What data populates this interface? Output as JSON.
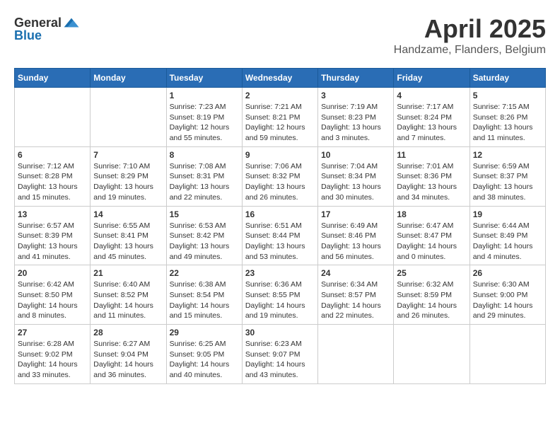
{
  "header": {
    "logo_general": "General",
    "logo_blue": "Blue",
    "title": "April 2025",
    "subtitle": "Handzame, Flanders, Belgium"
  },
  "weekdays": [
    "Sunday",
    "Monday",
    "Tuesday",
    "Wednesday",
    "Thursday",
    "Friday",
    "Saturday"
  ],
  "weeks": [
    [
      {
        "day": "",
        "detail": ""
      },
      {
        "day": "",
        "detail": ""
      },
      {
        "day": "1",
        "detail": "Sunrise: 7:23 AM\nSunset: 8:19 PM\nDaylight: 12 hours and 55 minutes."
      },
      {
        "day": "2",
        "detail": "Sunrise: 7:21 AM\nSunset: 8:21 PM\nDaylight: 12 hours and 59 minutes."
      },
      {
        "day": "3",
        "detail": "Sunrise: 7:19 AM\nSunset: 8:23 PM\nDaylight: 13 hours and 3 minutes."
      },
      {
        "day": "4",
        "detail": "Sunrise: 7:17 AM\nSunset: 8:24 PM\nDaylight: 13 hours and 7 minutes."
      },
      {
        "day": "5",
        "detail": "Sunrise: 7:15 AM\nSunset: 8:26 PM\nDaylight: 13 hours and 11 minutes."
      }
    ],
    [
      {
        "day": "6",
        "detail": "Sunrise: 7:12 AM\nSunset: 8:28 PM\nDaylight: 13 hours and 15 minutes."
      },
      {
        "day": "7",
        "detail": "Sunrise: 7:10 AM\nSunset: 8:29 PM\nDaylight: 13 hours and 19 minutes."
      },
      {
        "day": "8",
        "detail": "Sunrise: 7:08 AM\nSunset: 8:31 PM\nDaylight: 13 hours and 22 minutes."
      },
      {
        "day": "9",
        "detail": "Sunrise: 7:06 AM\nSunset: 8:32 PM\nDaylight: 13 hours and 26 minutes."
      },
      {
        "day": "10",
        "detail": "Sunrise: 7:04 AM\nSunset: 8:34 PM\nDaylight: 13 hours and 30 minutes."
      },
      {
        "day": "11",
        "detail": "Sunrise: 7:01 AM\nSunset: 8:36 PM\nDaylight: 13 hours and 34 minutes."
      },
      {
        "day": "12",
        "detail": "Sunrise: 6:59 AM\nSunset: 8:37 PM\nDaylight: 13 hours and 38 minutes."
      }
    ],
    [
      {
        "day": "13",
        "detail": "Sunrise: 6:57 AM\nSunset: 8:39 PM\nDaylight: 13 hours and 41 minutes."
      },
      {
        "day": "14",
        "detail": "Sunrise: 6:55 AM\nSunset: 8:41 PM\nDaylight: 13 hours and 45 minutes."
      },
      {
        "day": "15",
        "detail": "Sunrise: 6:53 AM\nSunset: 8:42 PM\nDaylight: 13 hours and 49 minutes."
      },
      {
        "day": "16",
        "detail": "Sunrise: 6:51 AM\nSunset: 8:44 PM\nDaylight: 13 hours and 53 minutes."
      },
      {
        "day": "17",
        "detail": "Sunrise: 6:49 AM\nSunset: 8:46 PM\nDaylight: 13 hours and 56 minutes."
      },
      {
        "day": "18",
        "detail": "Sunrise: 6:47 AM\nSunset: 8:47 PM\nDaylight: 14 hours and 0 minutes."
      },
      {
        "day": "19",
        "detail": "Sunrise: 6:44 AM\nSunset: 8:49 PM\nDaylight: 14 hours and 4 minutes."
      }
    ],
    [
      {
        "day": "20",
        "detail": "Sunrise: 6:42 AM\nSunset: 8:50 PM\nDaylight: 14 hours and 8 minutes."
      },
      {
        "day": "21",
        "detail": "Sunrise: 6:40 AM\nSunset: 8:52 PM\nDaylight: 14 hours and 11 minutes."
      },
      {
        "day": "22",
        "detail": "Sunrise: 6:38 AM\nSunset: 8:54 PM\nDaylight: 14 hours and 15 minutes."
      },
      {
        "day": "23",
        "detail": "Sunrise: 6:36 AM\nSunset: 8:55 PM\nDaylight: 14 hours and 19 minutes."
      },
      {
        "day": "24",
        "detail": "Sunrise: 6:34 AM\nSunset: 8:57 PM\nDaylight: 14 hours and 22 minutes."
      },
      {
        "day": "25",
        "detail": "Sunrise: 6:32 AM\nSunset: 8:59 PM\nDaylight: 14 hours and 26 minutes."
      },
      {
        "day": "26",
        "detail": "Sunrise: 6:30 AM\nSunset: 9:00 PM\nDaylight: 14 hours and 29 minutes."
      }
    ],
    [
      {
        "day": "27",
        "detail": "Sunrise: 6:28 AM\nSunset: 9:02 PM\nDaylight: 14 hours and 33 minutes."
      },
      {
        "day": "28",
        "detail": "Sunrise: 6:27 AM\nSunset: 9:04 PM\nDaylight: 14 hours and 36 minutes."
      },
      {
        "day": "29",
        "detail": "Sunrise: 6:25 AM\nSunset: 9:05 PM\nDaylight: 14 hours and 40 minutes."
      },
      {
        "day": "30",
        "detail": "Sunrise: 6:23 AM\nSunset: 9:07 PM\nDaylight: 14 hours and 43 minutes."
      },
      {
        "day": "",
        "detail": ""
      },
      {
        "day": "",
        "detail": ""
      },
      {
        "day": "",
        "detail": ""
      }
    ]
  ]
}
